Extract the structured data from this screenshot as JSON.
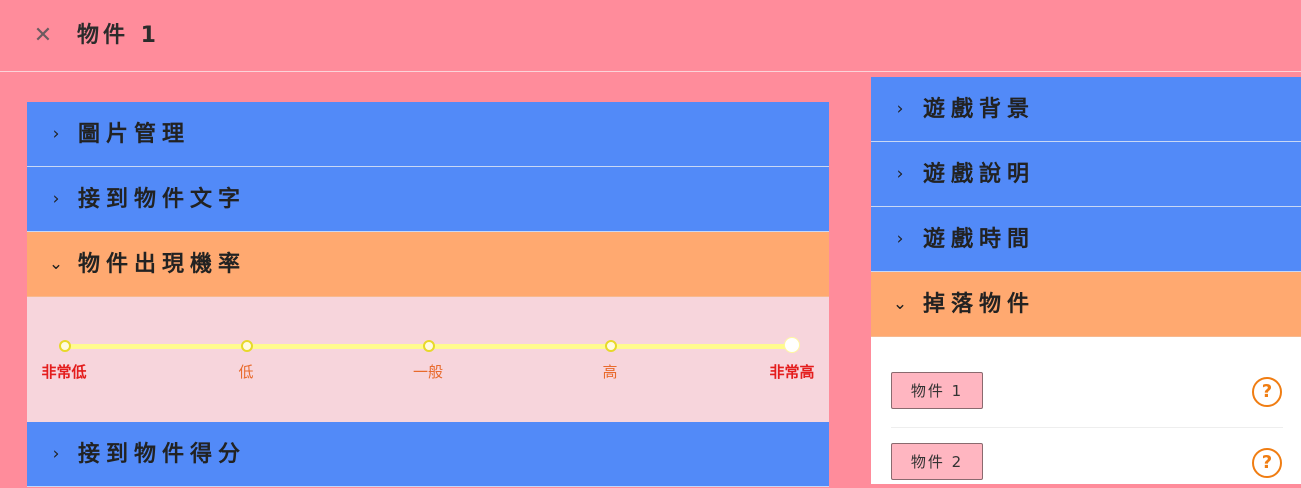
{
  "header": {
    "close_icon": "✕",
    "title": "物件 1"
  },
  "left_panel": {
    "sections": [
      {
        "label": "圖片管理",
        "expanded": false
      },
      {
        "label": "接到物件文字",
        "expanded": false
      },
      {
        "label": "物件出現機率",
        "expanded": true
      },
      {
        "label": "接到物件得分",
        "expanded": false
      }
    ],
    "probability_slider": {
      "labels": [
        "非常低",
        "低",
        "一般",
        "高",
        "非常高"
      ],
      "selected_index": 4
    }
  },
  "right_panel": {
    "sections": [
      {
        "label": "遊戲背景",
        "expanded": false
      },
      {
        "label": "遊戲說明",
        "expanded": false
      },
      {
        "label": "遊戲時間",
        "expanded": false
      },
      {
        "label": "掉落物件",
        "expanded": true
      }
    ],
    "drop_items": [
      {
        "label": "物件 1",
        "help_icon": "?"
      },
      {
        "label": "物件 2",
        "help_icon": "?"
      }
    ]
  },
  "icons": {
    "collapsed_chevron": "›",
    "expanded_chevron": "⌄"
  },
  "colors": {
    "background": "#ff8c9b",
    "header_collapsed": "#528af8",
    "header_expanded": "#ffa970",
    "slider_body": "#f7d5dc",
    "slider_track": "#fffb8e",
    "label_highlight": "#e41d1d",
    "label_normal": "#e86a2c",
    "item_button": "#ffb6c1",
    "help_icon": "#f07d12"
  }
}
